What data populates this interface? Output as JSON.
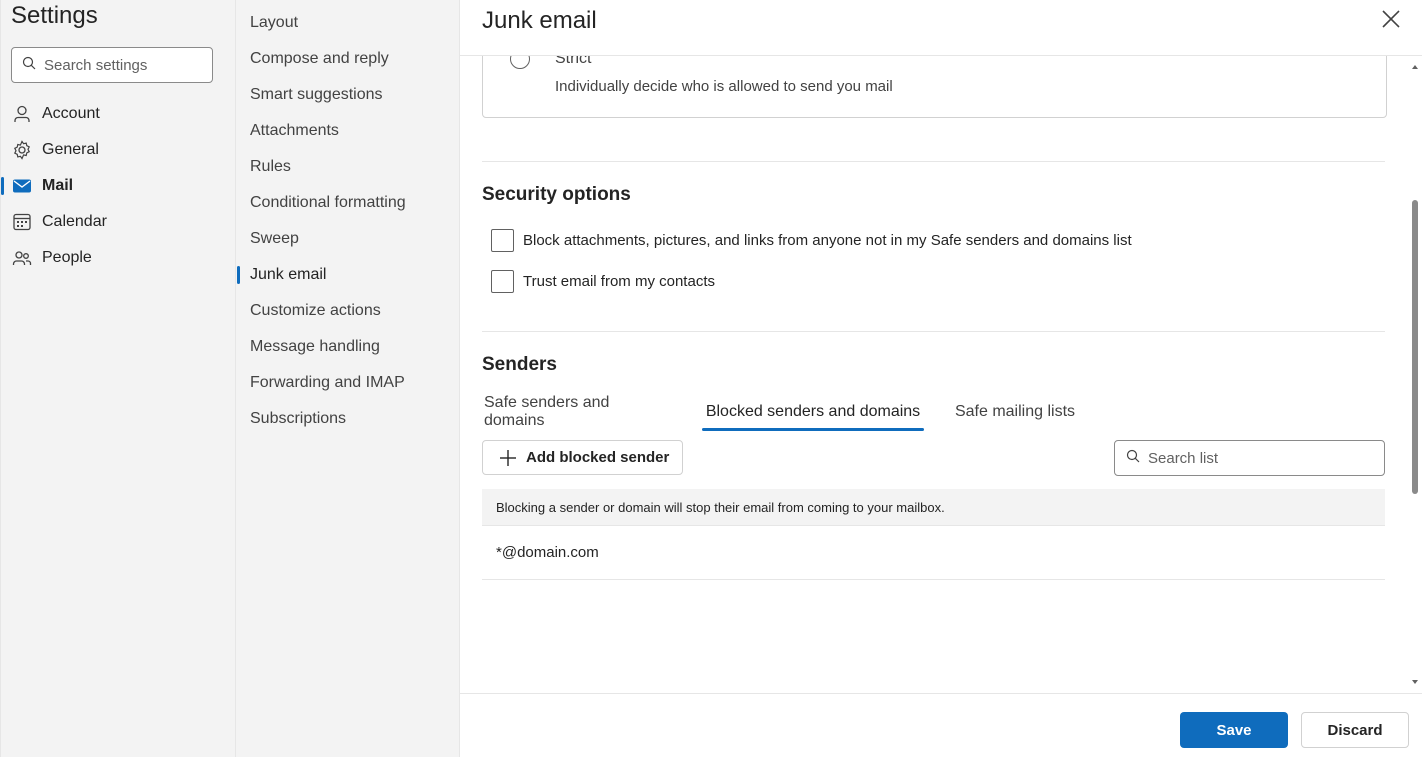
{
  "sidebar": {
    "title": "Settings",
    "search_placeholder": "Search settings",
    "items": [
      {
        "label": "Account",
        "icon": "person-icon"
      },
      {
        "label": "General",
        "icon": "gear-icon"
      },
      {
        "label": "Mail",
        "icon": "mail-icon"
      },
      {
        "label": "Calendar",
        "icon": "calendar-icon"
      },
      {
        "label": "People",
        "icon": "people-icon"
      }
    ],
    "active": "Mail"
  },
  "subnav": {
    "items": [
      "Layout",
      "Compose and reply",
      "Smart suggestions",
      "Attachments",
      "Rules",
      "Conditional formatting",
      "Sweep",
      "Junk email",
      "Customize actions",
      "Message handling",
      "Forwarding and IMAP",
      "Subscriptions"
    ],
    "active": "Junk email"
  },
  "main": {
    "title": "Junk email",
    "filter_option": {
      "label": "Strict",
      "description": "Individually decide who is allowed to send you mail"
    },
    "security": {
      "title": "Security options",
      "options": [
        {
          "label": "Block attachments, pictures, and links from anyone not in my Safe senders and domains list",
          "checked": false
        },
        {
          "label": "Trust email from my contacts",
          "checked": false
        }
      ]
    },
    "senders": {
      "title": "Senders",
      "tabs": [
        "Safe senders and domains",
        "Blocked senders and domains",
        "Safe mailing lists"
      ],
      "active_tab": "Blocked senders and domains",
      "add_button": "Add blocked sender",
      "search_placeholder": "Search list",
      "info": "Blocking a sender or domain will stop their email from coming to your mailbox.",
      "list": [
        "*@domain.com"
      ]
    }
  },
  "footer": {
    "save_label": "Save",
    "discard_label": "Discard"
  },
  "colors": {
    "accent": "#0f6cbd",
    "nav_background": "#f3f3f3"
  }
}
